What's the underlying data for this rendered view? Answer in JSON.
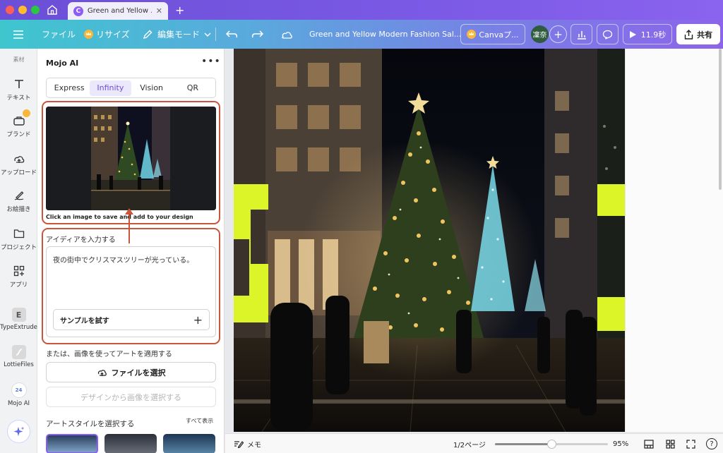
{
  "browser": {
    "tab_title": "Green and Yellow ...",
    "tab_favicon": "C",
    "new_tab": "+"
  },
  "toolbar": {
    "file_label": "ファイル",
    "resize_label": "リサイズ",
    "edit_mode_label": "編集モード",
    "doc_title": "Green and Yellow Modern Fashion Sal...",
    "canva_pro_label": "Canvaプ...",
    "avatar_initials": "凜奈",
    "play_duration": "11.9秒",
    "share_label": "共有"
  },
  "rail": {
    "top_label": "素材",
    "items": [
      {
        "label": "テキスト",
        "icon": "text-icon"
      },
      {
        "label": "ブランド",
        "icon": "brand-icon"
      },
      {
        "label": "アップロード",
        "icon": "upload-icon"
      },
      {
        "label": "お絵描き",
        "icon": "draw-icon"
      },
      {
        "label": "プロジェクト",
        "icon": "folder-icon"
      },
      {
        "label": "アプリ",
        "icon": "apps-icon"
      },
      {
        "label": "TypeExtrude",
        "icon": "typeextrude-icon"
      },
      {
        "label": "LottieFiles",
        "icon": "lottiefiles-icon"
      },
      {
        "label": "Mojo AI",
        "icon": "mojo-ai-icon"
      }
    ]
  },
  "panel": {
    "title": "Mojo AI",
    "tabs": [
      "Express",
      "Infinity",
      "Vision",
      "QR"
    ],
    "active_tab": "Infinity",
    "preview_caption": "Click an image to save and add to your design",
    "idea_label": "アイディアを入力する",
    "idea_text": "夜の街中でクリスマスツリーが光っている。",
    "sample_button": "サンプルを試す",
    "or_label": "または、画像を使ってアートを適用する",
    "file_button": "ファイルを選択",
    "design_button": "デザインから画像を選択する",
    "art_style_label": "アートスタイルを選択する",
    "show_all": "すべて表示"
  },
  "footer": {
    "notes_label": "メモ",
    "page_indicator": "1/2ページ",
    "zoom_value": "95%",
    "zoom_fraction": 0.5,
    "help": "?"
  },
  "colors": {
    "accent": "#6b4fd6",
    "annotation": "#c9553a",
    "highlight_yellow": "#dcf528"
  }
}
